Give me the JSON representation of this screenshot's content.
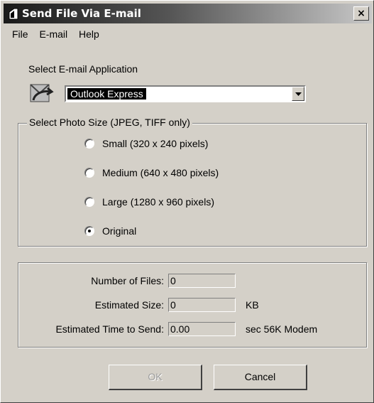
{
  "window": {
    "title": "Send File Via E-mail",
    "close_label": "×"
  },
  "menu": [
    "File",
    "E-mail",
    "Help"
  ],
  "app_section": {
    "label": "Select E-mail Application",
    "selected": "Outlook Express"
  },
  "photo_size": {
    "legend": "Select Photo Size (JPEG, TIFF only)",
    "options": [
      {
        "label": "Small (320 x 240 pixels)",
        "checked": false
      },
      {
        "label": "Medium (640 x 480 pixels)",
        "checked": false
      },
      {
        "label": "Large (1280 x 960 pixels)",
        "checked": false
      },
      {
        "label": "Original",
        "checked": true
      }
    ]
  },
  "stats": {
    "files_label": "Number of Files:",
    "files_value": "0",
    "size_label": "Estimated Size:",
    "size_value": "0",
    "size_unit": "KB",
    "time_label": "Estimated Time to Send:",
    "time_value": "0.00",
    "time_unit": "sec 56K Modem"
  },
  "buttons": {
    "ok": "OK",
    "cancel": "Cancel"
  }
}
